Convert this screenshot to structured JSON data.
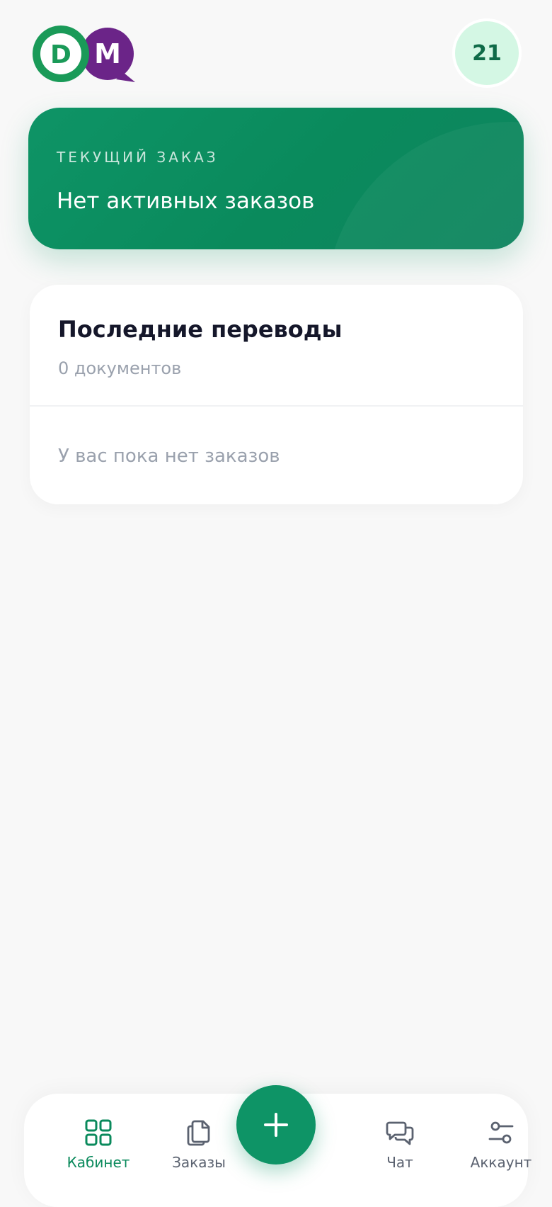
{
  "header": {
    "logo_letters": [
      "D",
      "M"
    ],
    "avatar_text": "21"
  },
  "current_order": {
    "label": "ТЕКУЩИЙ ЗАКАЗ",
    "status": "Нет активных заказов"
  },
  "recent": {
    "title": "Последние переводы",
    "count": "0 документов",
    "empty_text": "У вас пока нет заказов"
  },
  "nav": {
    "items": [
      {
        "label": "Кабинет",
        "icon": "grid-icon",
        "active": true
      },
      {
        "label": "Заказы",
        "icon": "documents-icon",
        "active": false
      },
      {
        "label": "Чат",
        "icon": "chat-icon",
        "active": false
      },
      {
        "label": "Аккаунт",
        "icon": "settings-icon",
        "active": false
      }
    ],
    "fab_icon": "plus-icon"
  },
  "colors": {
    "primary": "#0e9466",
    "logo_green": "#1a9a58",
    "logo_purple": "#6b2488",
    "avatar_bg": "#d4f7e4",
    "muted_text": "#9aa1ad",
    "title_text": "#15172a"
  }
}
